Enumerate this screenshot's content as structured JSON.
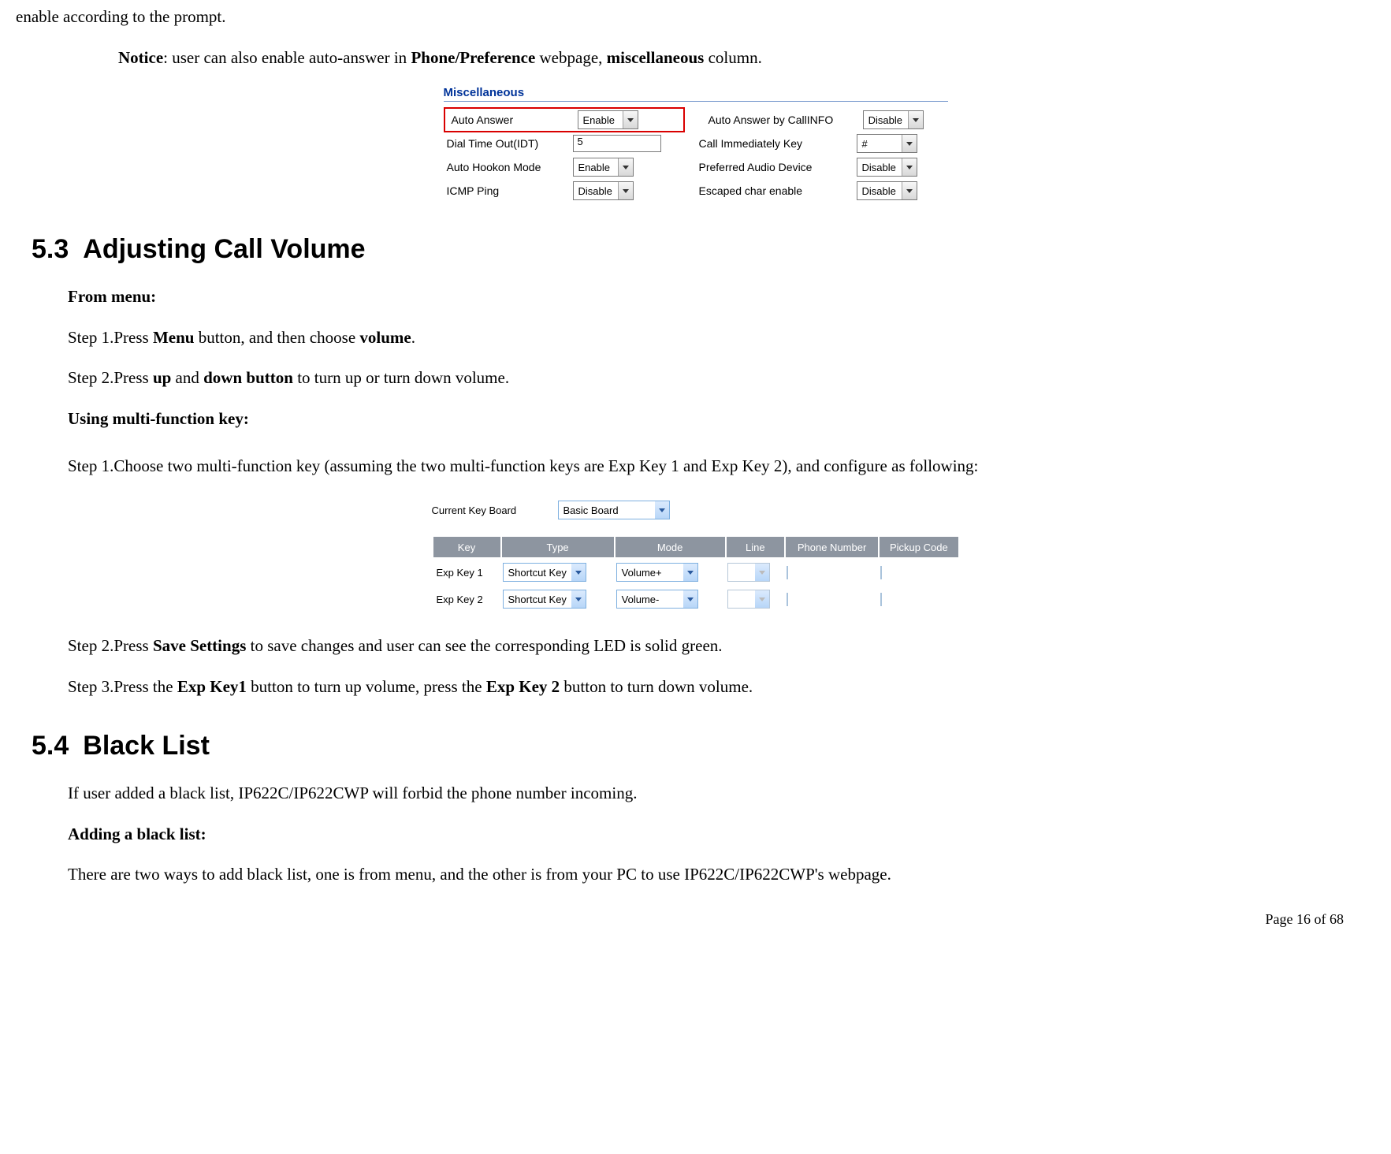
{
  "intro_fragment": "enable according to the prompt.",
  "notice_prefix": "Notice",
  "notice_text1": ": user can also enable auto-answer in ",
  "notice_text2": " webpage, ",
  "notice_text3": " column.",
  "notice_bold1": "Phone/Preference",
  "notice_bold2": "miscellaneous",
  "misc": {
    "title": "Miscellaneous",
    "rows": [
      {
        "l_label": "Auto Answer",
        "l_ctrl": {
          "type": "select",
          "value": "Enable"
        },
        "r_label": "Auto Answer by CallINFO",
        "r_ctrl": {
          "type": "select",
          "value": "Disable"
        },
        "highlight": true
      },
      {
        "l_label": "Dial Time Out(IDT)",
        "l_ctrl": {
          "type": "input",
          "value": "5"
        },
        "r_label": "Call Immediately Key",
        "r_ctrl": {
          "type": "select",
          "value": "#"
        }
      },
      {
        "l_label": "Auto Hookon Mode",
        "l_ctrl": {
          "type": "select",
          "value": "Enable"
        },
        "r_label": "Preferred Audio Device",
        "r_ctrl": {
          "type": "select",
          "value": "Disable"
        }
      },
      {
        "l_label": "ICMP Ping",
        "l_ctrl": {
          "type": "select",
          "value": "Disable"
        },
        "r_label": "Escaped char enable",
        "r_ctrl": {
          "type": "select",
          "value": "Disable"
        }
      }
    ]
  },
  "sec53_num": "5.3",
  "sec53_title": "Adjusting Call Volume",
  "from_menu": "From menu:",
  "s1a": "Step 1.Press ",
  "s1b": "Menu",
  "s1c": " button, and then choose ",
  "s1d": "volume",
  "s1e": ".",
  "s2a": "Step 2.Press ",
  "s2b": "up",
  "s2c": " and ",
  "s2d": "down button",
  "s2e": " to turn up or turn down volume.",
  "using_mfk": "Using multi-function key:",
  "mfk_step1": "Step 1.Choose two multi-function key (assuming the two multi-function keys are Exp Key 1 and Exp Key 2), and configure as following:",
  "kb": {
    "top_label": "Current Key Board",
    "top_value": "Basic Board",
    "headers": [
      "Key",
      "Type",
      "Mode",
      "Line",
      "Phone Number",
      "Pickup Code"
    ],
    "rows": [
      {
        "key": "Exp Key 1",
        "type": "Shortcut Key",
        "mode": "Volume+",
        "line": "",
        "phone": "",
        "pickup": ""
      },
      {
        "key": "Exp Key 2",
        "type": "Shortcut Key",
        "mode": "Volume-",
        "line": "",
        "phone": "",
        "pickup": ""
      }
    ]
  },
  "mfk_s2a": "Step 2.Press ",
  "mfk_s2b": "Save Settings",
  "mfk_s2c": " to save changes and user can see the corresponding LED is solid green.",
  "mfk_s3a": "Step 3.Press the ",
  "mfk_s3b": "Exp Key1",
  "mfk_s3c": " button to turn up volume, press the ",
  "mfk_s3d": "Exp Key 2",
  "mfk_s3e": " button to turn down volume.",
  "sec54_num": "5.4",
  "sec54_title": "Black List",
  "bl_intro": "If user added a black list, IP622C/IP622CWP will forbid the phone number incoming.",
  "bl_adding": "Adding a black list:",
  "bl_ways": "There are two ways to add black list, one is from menu, and the other is from your PC to use IP622C/IP622CWP's webpage.",
  "footer": "Page 16 of 68"
}
